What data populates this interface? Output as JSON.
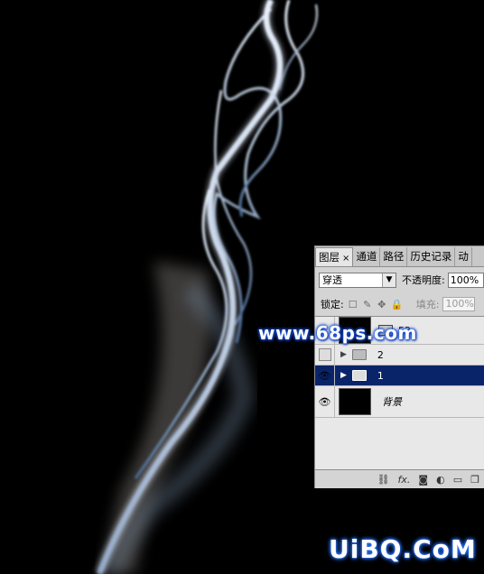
{
  "panel": {
    "tabs": [
      {
        "label": "图层",
        "close": "×"
      },
      {
        "label": "通道"
      },
      {
        "label": "路径"
      },
      {
        "label": "历史记录"
      },
      {
        "label": "动"
      }
    ],
    "blend_mode": "穿透",
    "opacity_label": "不透明度:",
    "opacity_value": "100%",
    "lock_label": "锁定:",
    "fill_label": "填充:",
    "fill_value": "100%",
    "layers": [
      {
        "name": "52",
        "type": "layer",
        "visible": false
      },
      {
        "name": "2",
        "type": "group",
        "visible": false
      },
      {
        "name": "1",
        "type": "group",
        "visible": true,
        "selected": true
      },
      {
        "name": "背景",
        "type": "background",
        "visible": true
      }
    ],
    "bottom_icons": [
      "link-icon",
      "fx-icon",
      "mask-icon",
      "adjustment-icon",
      "folder-icon",
      "new-layer-icon"
    ],
    "fx_label": "fx."
  },
  "watermark": "www.68ps.com",
  "brand": "UiBQ.CoM",
  "colors": {
    "selected_layer": "#0a246a",
    "smoke": "#b8c8dc",
    "watermark_glow": "#1a4fd0"
  }
}
